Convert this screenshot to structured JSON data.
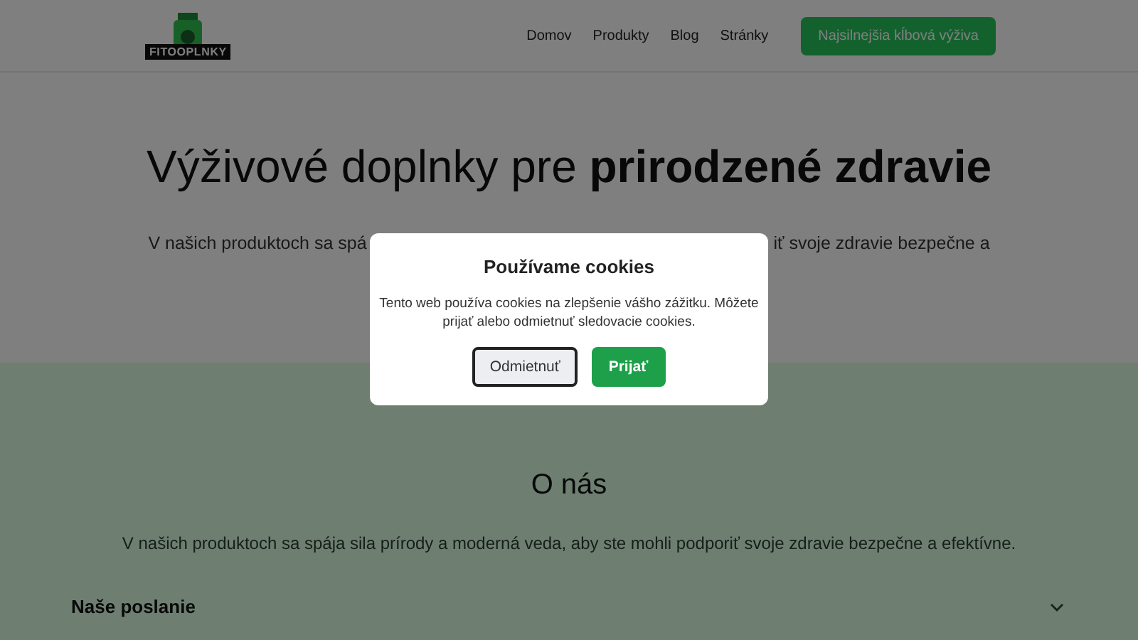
{
  "header": {
    "logo_text": "FITOOPLNKY",
    "nav": [
      {
        "label": "Domov"
      },
      {
        "label": "Produkty"
      },
      {
        "label": "Blog"
      },
      {
        "label": "Stránky"
      }
    ],
    "cta": "Najsilnejšia kĺbová výživa"
  },
  "hero": {
    "title": "Výživové doplnky pre **prirodzené zdravie**",
    "text_left": "V našich produktoch sa spá",
    "text_right": "iť svoje zdravie bezpečne a"
  },
  "about": {
    "title": "O nás",
    "text": "V našich produktoch sa spája sila prírody a moderná veda, aby ste mohli podporiť svoje zdravie bezpečne a efektívne.",
    "accordion": [
      {
        "label": "Naše poslanie",
        "expanded": false
      }
    ]
  },
  "cookie_dialog": {
    "title": "Používame cookies",
    "text": "Tento web používa cookies na zlepšenie vášho zážitku. Môžete prijať alebo odmietnuť sledovacie cookies.",
    "buttons": [
      {
        "label": "Odmietnuť",
        "kind": "secondary"
      },
      {
        "label": "Prijať",
        "kind": "primary"
      }
    ]
  }
}
